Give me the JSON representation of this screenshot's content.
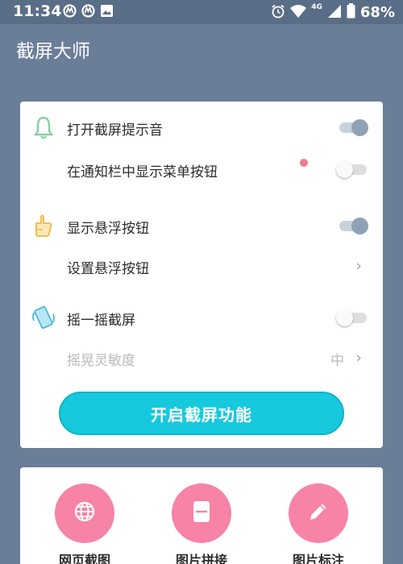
{
  "status_bar": {
    "time": "11:34",
    "battery": "68%",
    "network": "4G",
    "left_icons": [
      "moto-icon",
      "moto-icon",
      "image-icon"
    ],
    "right_icons": [
      "alarm-icon",
      "wifi-icon",
      "signal-icon",
      "battery-icon"
    ]
  },
  "app": {
    "title": "截屏大师"
  },
  "settings": {
    "sound_label": "打开截屏提示音",
    "sound_on": true,
    "notif_label": "在通知栏中显示菜单按钮",
    "notif_on": false,
    "show_float_label": "显示悬浮按钮",
    "show_float_on": true,
    "set_float_label": "设置悬浮按钮",
    "shake_label": "摇一摇截屏",
    "shake_on": false,
    "sensitivity_label": "摇晃灵敏度",
    "sensitivity_value": "中",
    "start_button": "开启截屏功能"
  },
  "tools": [
    {
      "label": "网页截图",
      "icon": "globe-icon"
    },
    {
      "label": "图片拼接",
      "icon": "stitch-icon"
    },
    {
      "label": "图片标注",
      "icon": "pencil-icon"
    }
  ],
  "colors": {
    "background": "#6b7e97",
    "accent": "#16c9de",
    "tool_circle": "#f783a7",
    "toggle_on": "#8fa1b5",
    "notification_dot": "#f27b8f"
  }
}
